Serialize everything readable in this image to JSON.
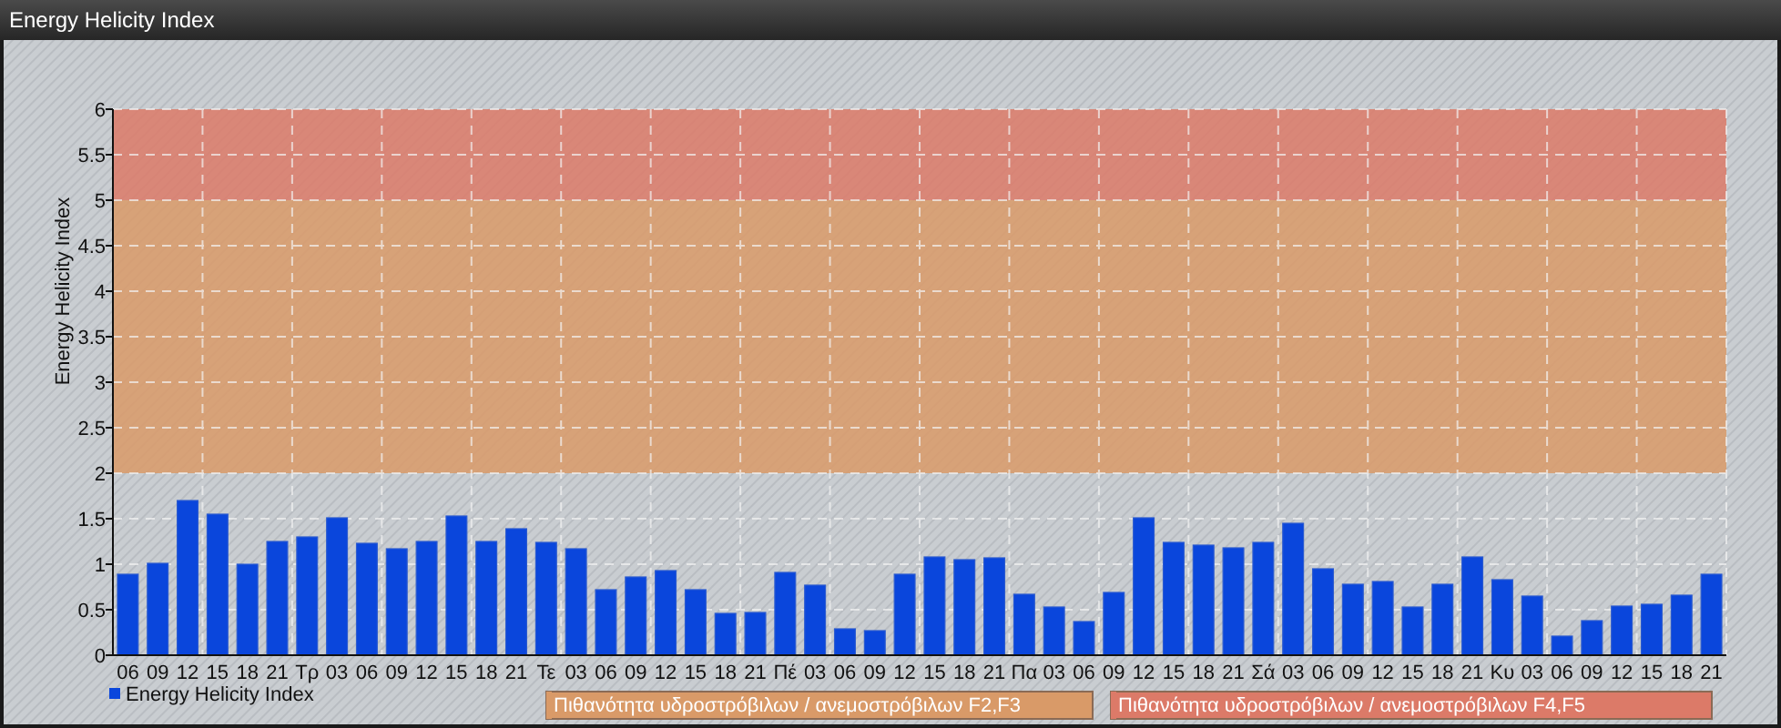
{
  "window": {
    "title": "Energy Helicity Index"
  },
  "chart_data": {
    "type": "bar",
    "ylabel": "Energy Helicity Index",
    "categories": [
      "06",
      "09",
      "12",
      "15",
      "18",
      "21",
      "Τρ",
      "03",
      "06",
      "09",
      "12",
      "15",
      "18",
      "21",
      "Τε",
      "03",
      "06",
      "09",
      "12",
      "15",
      "18",
      "21",
      "Πέ",
      "03",
      "06",
      "09",
      "12",
      "15",
      "18",
      "21",
      "Πα",
      "03",
      "06",
      "09",
      "12",
      "15",
      "18",
      "21",
      "Σά",
      "03",
      "06",
      "09",
      "12",
      "15",
      "18",
      "21",
      "Κυ",
      "03",
      "06",
      "09",
      "12",
      "15",
      "18",
      "21"
    ],
    "series": [
      {
        "name": "Energy Helicity Index",
        "color": "#0a46dc",
        "values": [
          0.89,
          1.01,
          1.7,
          1.55,
          1.0,
          1.25,
          1.3,
          1.51,
          1.23,
          1.17,
          1.25,
          1.53,
          1.25,
          1.39,
          1.24,
          1.17,
          0.72,
          0.86,
          0.93,
          0.72,
          0.46,
          0.47,
          0.91,
          0.77,
          0.29,
          0.27,
          0.89,
          1.08,
          1.05,
          1.07,
          0.67,
          0.53,
          0.37,
          0.69,
          1.51,
          1.24,
          1.21,
          1.18,
          1.24,
          1.45,
          0.95,
          0.78,
          0.81,
          0.53,
          0.78,
          1.08,
          0.83,
          0.65,
          0.21,
          0.38,
          0.54,
          0.56,
          0.66,
          0.89
        ]
      }
    ],
    "ylim": [
      0,
      6
    ],
    "yticks": [
      0,
      0.5,
      1,
      1.5,
      2,
      2.5,
      3,
      3.5,
      4,
      4.5,
      5,
      5.5,
      6
    ],
    "grid": true,
    "legend": "bottom",
    "bands": [
      {
        "axis": "y",
        "from": 2,
        "to": 5,
        "color": "#d99a68",
        "label": "Πιθανότητα υδροστρόβιλων / ανεμοστρόβιλων F2,F3"
      },
      {
        "axis": "y",
        "from": 5,
        "to": 6,
        "color": "#dc7a68",
        "label": "Πιθανότητα υδροστρόβιλων / ανεμοστρόβιλων F4,F5"
      }
    ]
  }
}
